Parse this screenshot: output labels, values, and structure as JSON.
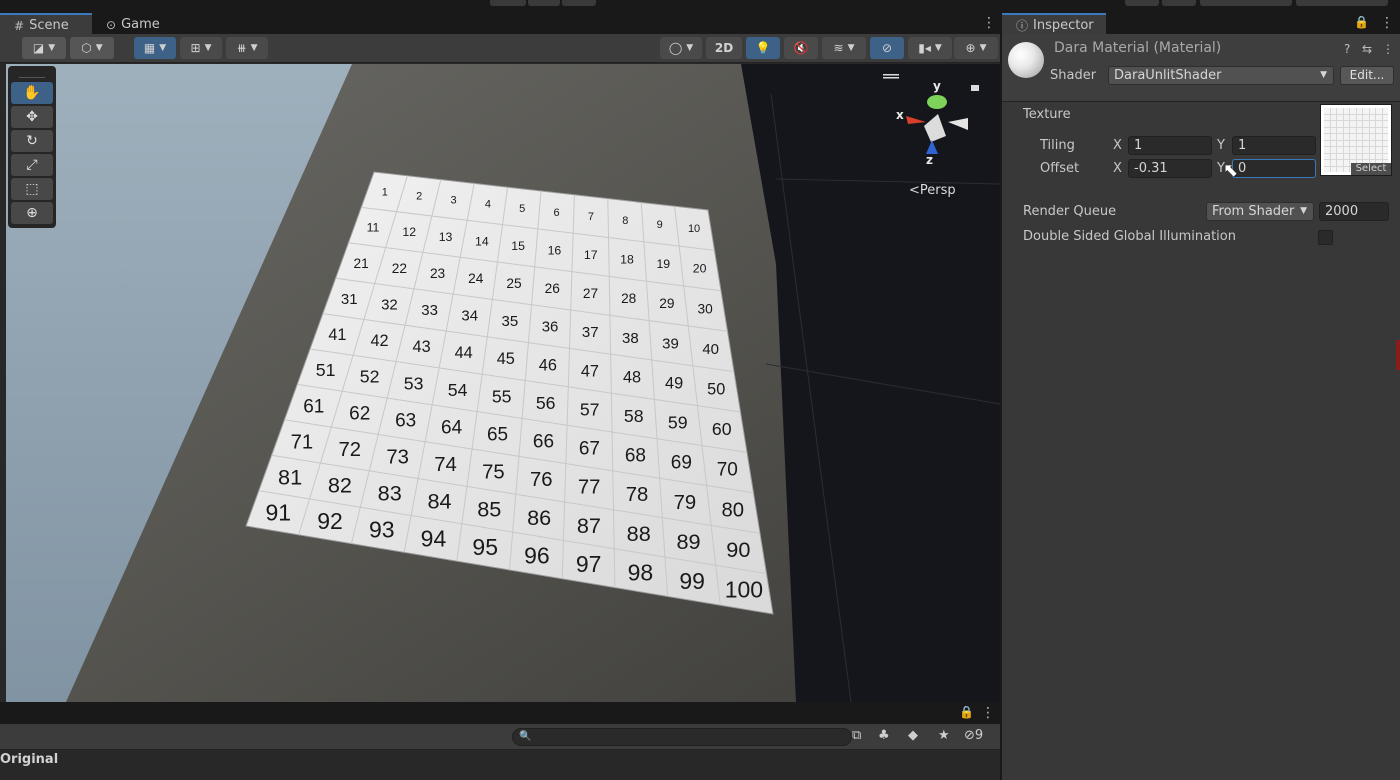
{
  "scene_tabs": [
    {
      "label": "Scene",
      "glyph": "#"
    },
    {
      "label": "Game",
      "glyph": "⊙"
    }
  ],
  "scene_toolbar": {
    "mode_2d": "2D"
  },
  "tools": [
    "hand-tool",
    "move-tool",
    "rotate-tool",
    "scale-tool",
    "rect-tool",
    "transform-tool"
  ],
  "gizmo": {
    "x": "x",
    "y": "y",
    "z": "z",
    "persp": "Persp"
  },
  "numbered_grid": {
    "rows": [
      [
        "1",
        "2",
        "3",
        "4",
        "5",
        "6",
        "7",
        "8",
        "9",
        "10"
      ],
      [
        "11",
        "12",
        "13",
        "14",
        "15",
        "16",
        "17",
        "18",
        "19",
        "20"
      ],
      [
        "21",
        "22",
        "23",
        "24",
        "25",
        "26",
        "27",
        "28",
        "29",
        "30"
      ],
      [
        "31",
        "32",
        "33",
        "34",
        "35",
        "36",
        "37",
        "38",
        "39",
        "40"
      ],
      [
        "41",
        "42",
        "43",
        "44",
        "45",
        "46",
        "47",
        "48",
        "49",
        "50"
      ],
      [
        "51",
        "52",
        "53",
        "54",
        "55",
        "56",
        "57",
        "58",
        "59",
        "60"
      ],
      [
        "61",
        "62",
        "63",
        "64",
        "65",
        "66",
        "67",
        "68",
        "69",
        "70"
      ],
      [
        "71",
        "72",
        "73",
        "74",
        "75",
        "76",
        "77",
        "78",
        "79",
        "80"
      ],
      [
        "81",
        "82",
        "83",
        "84",
        "85",
        "86",
        "87",
        "88",
        "89",
        "90"
      ],
      [
        "91",
        "92",
        "93",
        "94",
        "95",
        "96",
        "97",
        "98",
        "99",
        "100"
      ]
    ]
  },
  "bottom_panel": {
    "hidden_count": "9",
    "label": "Original"
  },
  "inspector": {
    "tab_label": "Inspector",
    "material_title": "Dara Material (Material)",
    "shader_label": "Shader",
    "shader_value": "DaraUnlitShader",
    "edit_button": "Edit...",
    "texture_label": "Texture",
    "tiling_label": "Tiling",
    "offset_label": "Offset",
    "x_label": "X",
    "y_label": "Y",
    "tiling_x": "1",
    "tiling_y": "1",
    "offset_x": "-0.31",
    "offset_y": "0",
    "select_label": "Select",
    "render_queue_label": "Render Queue",
    "render_queue_mode": "From Shader",
    "render_queue_value": "2000",
    "double_sided_gi_label": "Double Sided Global Illumination"
  },
  "colors": {
    "accent_blue": "#3a79bb",
    "tool_selected": "#3e6187",
    "panel_bg": "#383838"
  }
}
